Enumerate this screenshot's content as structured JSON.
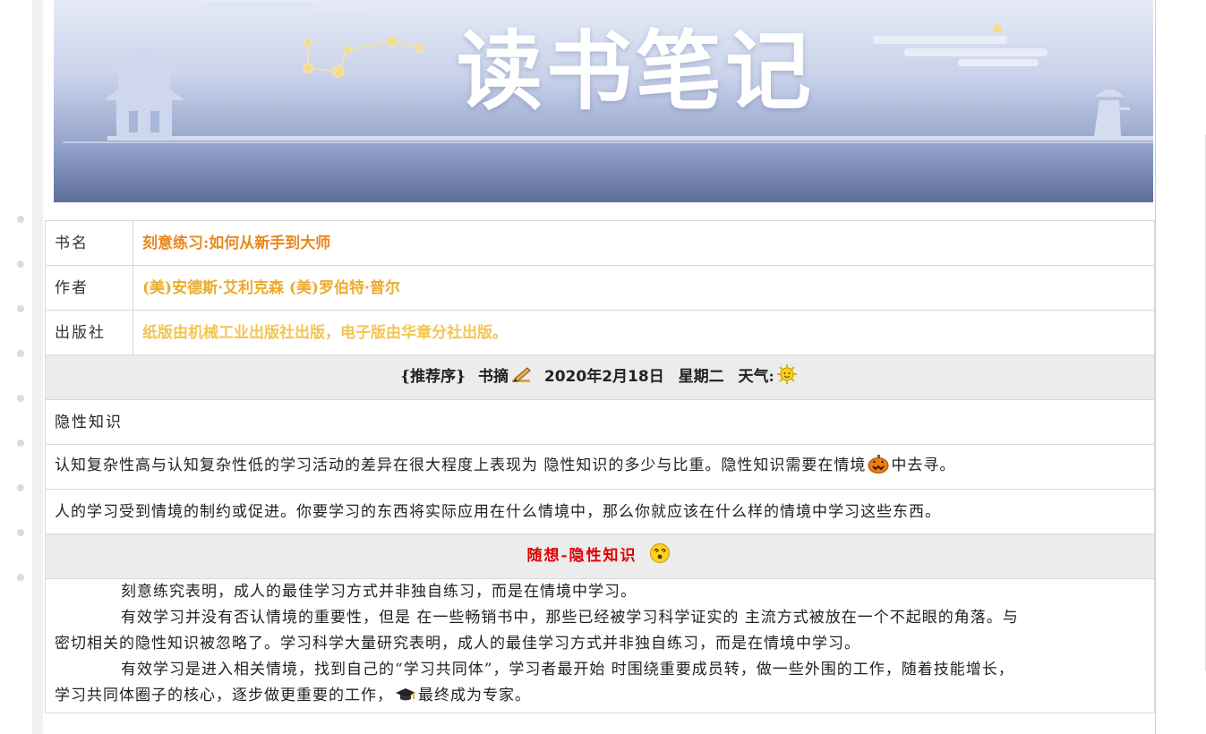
{
  "banner": {
    "title": "读书笔记"
  },
  "book": {
    "title_label": "书名",
    "title": "刻意练习:如何从新手到大师",
    "author_label": "作者",
    "author": "(美)安德斯·艾利克森 (美)罗伯特·普尔",
    "publisher_label": "出版社",
    "publisher": "纸版由机械工业出版社出版，电子版由华章分社出版。"
  },
  "excerpt_header": {
    "section": "{推荐序}",
    "kind": "书摘",
    "date": "2020年2月18日",
    "weekday": "星期二",
    "weather_label": "天气:"
  },
  "excerpt": {
    "topic": "隐性知识",
    "line1_a": "认知复杂性高与认知复杂性低的学习活动的差异在很大程度上表现为 隐性知识的多少与比重。隐性知识需要在情境",
    "line1_b": "中去寻。",
    "line2": "人的学习受到情境的制约或促进。你要学习的东西将实际应用在什么情境中，那么你就应该在什么样的情境中学习这些东西。"
  },
  "reflection": {
    "title": "随想-隐性知识",
    "p1": "刻意练究表明，成人的最佳学习方式并非独自练习，而是在情境中学习。",
    "p2_a": "有效学习并没有否认情境的重要性，但是 在一些畅销书中，那些已经被学习科学证实的 主流方式被放在一个不起眼的角落。与",
    "p2_b": "密切相关的隐性知识被忽略了。学习科学大量研究表明，成人的最佳学习方式并非独自练习，而是在情境中学习。",
    "p3_a": "有效学习是进入相关情境，找到自己的“学习共同体”，学习者最开始 时围绕重要成员转，做一些外围的工作，随着技能增长，",
    "p3_b1": "学习共同体圈子的核心，逐步做更重要的工作，",
    "p3_b2": "最终成为专家。"
  },
  "icons": {
    "pencil": "writing-pencil-icon",
    "weather": "sun-face-icon",
    "pumpkin": "jack-o-lantern-icon",
    "dizzy": "dizzy-face-icon",
    "grad": "graduation-cap-icon"
  },
  "colors": {
    "title": "#e8881f",
    "author": "#ecab2a",
    "publisher": "#f3c554",
    "reflection_title": "#e00000",
    "band_bg": "#ececec"
  }
}
